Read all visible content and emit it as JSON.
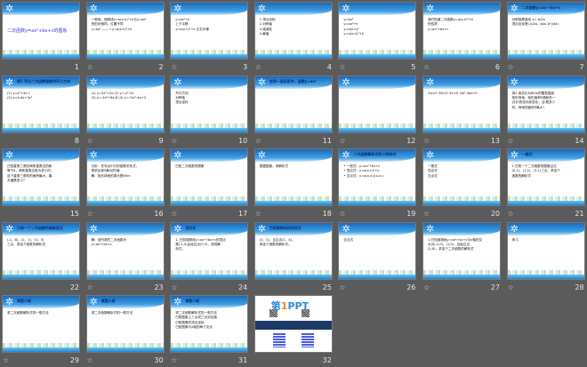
{
  "view": "slide-sorter",
  "slides": [
    {
      "n": "1",
      "anim": false,
      "title": "",
      "lines": [],
      "big": "二次函数y=ax²+bx+c的图象"
    },
    {
      "n": "2",
      "anim": true,
      "title": "",
      "lines": [
        "一般地，抛物线y=a(x-h)²+k与y=ax²",
        "的形状相同，位置不同",
        "y=ax²  ——→  y=a(x-h)²+k"
      ]
    },
    {
      "n": "3",
      "anim": true,
      "title": "",
      "lines": [
        "y=ax²+k",
        "上下平移",
        "y=a(x-h)²+k  左右平移"
      ]
    },
    {
      "n": "4",
      "anim": true,
      "title": "",
      "lines": [
        "1.顶点坐标",
        "2.对称轴",
        "3.增减性",
        "4.最值"
      ]
    },
    {
      "n": "5",
      "anim": true,
      "title": "",
      "lines": [
        "y=ax²",
        "y=ax²+k",
        "y=a(x-h)²",
        "y=a(x-h)²+k"
      ]
    },
    {
      "n": "6",
      "anim": true,
      "title": "",
      "lines": [
        "我们知道二次函数y=a(x-h)²+k",
        "的性质",
        "y=ax²+bx+c"
      ]
    },
    {
      "n": "7",
      "anim": true,
      "title": "二次函数y=ax²+bx+c",
      "lines": [
        "对称轴是直线 x=-b/2a",
        "顶点坐标是(-b/2a, (4ac-b²)/4a)"
      ]
    },
    {
      "n": "8",
      "anim": false,
      "title": "例1 写出二次函数图象的开口方向",
      "lines": [
        "(1) y=x²+4x-1",
        "(2) y=4-6x+3x²"
      ]
    },
    {
      "n": "9",
      "anim": true,
      "title": "",
      "lines": [
        "(1) y=2x²+2x    (2) y=-x²-2x",
        "(3) y=-2x²+8x-8  (4) y=-½x²-4x+3"
      ]
    },
    {
      "n": "10",
      "anim": true,
      "title": "",
      "lines": [
        "开口方向",
        "对称轴",
        "顶点坐标"
      ]
    },
    {
      "n": "11",
      "anim": true,
      "title": "在同一坐标系中，函数y=ax²",
      "lines": []
    },
    {
      "n": "12",
      "anim": true,
      "title": "",
      "lines": []
    },
    {
      "n": "13",
      "anim": true,
      "title": "",
      "lines": [
        "①a>0 ②b>0 ③c>0 ④b²-4ac>0"
      ]
    },
    {
      "n": "14",
      "anim": true,
      "title": "",
      "lines": [
        "例2 用总长为60m的篱笆围成",
        "矩形场地，矩形面积S随矩形一",
        "边长l的变化而变化，当l是多少",
        "时，场地的面积S最大？"
      ]
    },
    {
      "n": "15",
      "anim": false,
      "title": "",
      "lines": [
        "已知直角三角形两条直角边的和",
        "等于8，两条直角边各为多少时，",
        "这个直角三角形的面积最大，最",
        "大值是多少？"
      ]
    },
    {
      "n": "16",
      "anim": true,
      "title": "",
      "lines": [
        "分析：先写出S与l的函数关系式，",
        "再求出使S最大的l值",
        "解：矩形场地的周长是60m"
      ]
    },
    {
      "n": "17",
      "anim": true,
      "title": "",
      "lines": [
        "已知二次函数的图象"
      ]
    },
    {
      "n": "18",
      "anim": true,
      "title": "",
      "lines": [
        "根据图象，求解析式"
      ]
    },
    {
      "n": "19",
      "anim": true,
      "title": "二次函数解析式的三种形式",
      "lines": [
        "• 一般式：y=ax²+bx+c",
        "• 顶点式：y=a(x-h)²+k",
        "• 交点式：y=a(x-x₁)(x-x₂)"
      ]
    },
    {
      "n": "20",
      "anim": true,
      "title": "",
      "lines": [
        "一般式",
        "顶点式",
        "交点式"
      ]
    },
    {
      "n": "21",
      "anim": true,
      "title": "一般式",
      "lines": [
        "1.已知一个二次函数的图象过点",
        "(0,1)、(1,2)、(2,1)三点，求这个",
        "函数的解析式"
      ]
    },
    {
      "n": "22",
      "anim": false,
      "title": "已知一个二次函数的图象经过",
      "lines": [
        "(-1，8)，(2，1)，(3，5)",
        "三点，求这个函数的解析式"
      ]
    },
    {
      "n": "23",
      "anim": true,
      "title": "",
      "lines": [
        "解：设所求的二次函数为",
        "y=ax²+bx+c"
      ]
    },
    {
      "n": "24",
      "anim": true,
      "title": "顶点式",
      "lines": [
        "1. 已知抛物线y=ax²+bx+c的顶点",
        "是(-1,4)且经过点(0,3)，求其解",
        "析式。"
      ]
    },
    {
      "n": "25",
      "anim": false,
      "title": "已知抛物线的顶点为",
      "lines": [
        "(2，3)，且过点(1，4)，",
        "求这个函数的解析式。"
      ]
    },
    {
      "n": "26",
      "anim": true,
      "title": "",
      "lines": [
        "交点式"
      ]
    },
    {
      "n": "27",
      "anim": true,
      "title": "",
      "lines": [
        "1.已知抛物线y=ax²+bx+c与x轴的交",
        "点为(-2,0)、(1,0)，且经过点",
        "(2,8)，求这个二次函数的解析式"
      ]
    },
    {
      "n": "28",
      "anim": true,
      "title": "",
      "lines": [
        "练习"
      ]
    },
    {
      "n": "29",
      "anim": true,
      "title": "课堂小结",
      "lines": [
        "求二次函数解析式的一般方法"
      ]
    },
    {
      "n": "30",
      "anim": true,
      "title": "课堂小结",
      "lines": [
        "求二次函数解析式的一般方法"
      ]
    },
    {
      "n": "31",
      "anim": true,
      "title": "课堂小结",
      "lines": [
        "求二次函数解析式的一般方法",
        "已知图象上三点或三对对应值",
        "已知图象的顶点坐标",
        "已知图象与x轴的两个交点"
      ]
    },
    {
      "n": "32",
      "anim": false,
      "title": "",
      "lines": [],
      "ppt": true,
      "logo": "第1PPT"
    }
  ]
}
